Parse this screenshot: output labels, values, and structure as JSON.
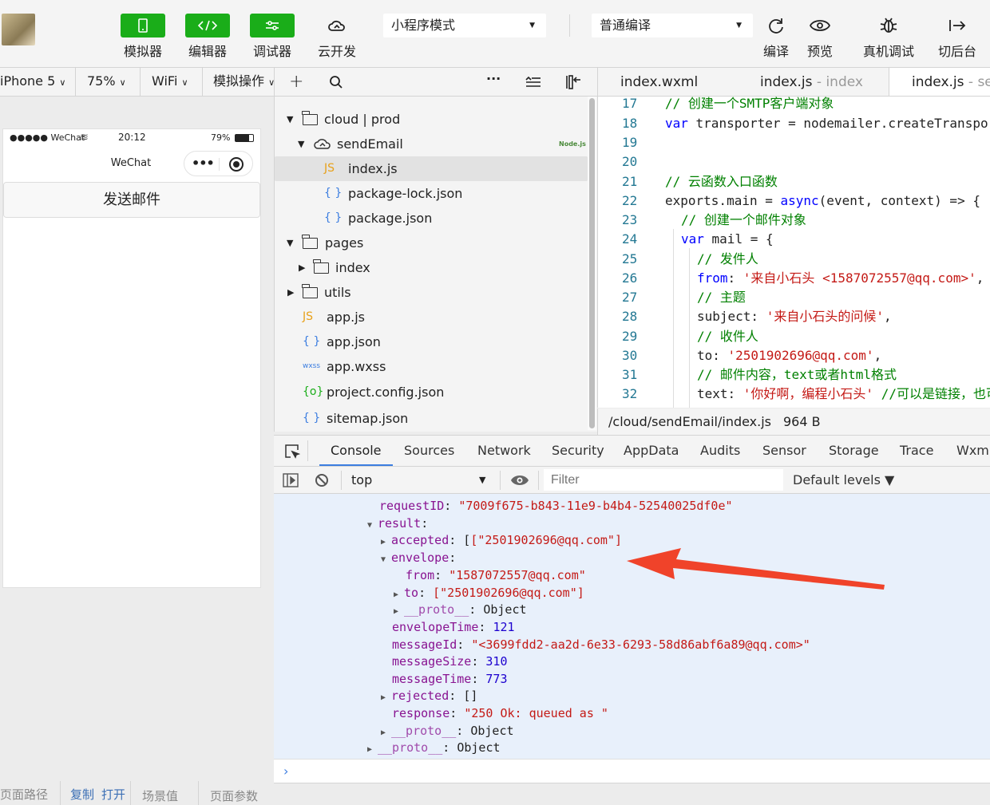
{
  "toolbar": {
    "simulator": "模拟器",
    "editor": "编辑器",
    "debugger": "调试器",
    "cloud": "云开发",
    "mode": "小程序模式",
    "compile_mode": "普通编译",
    "compile": "编译",
    "preview": "预览",
    "remote_debug": "真机调试",
    "background": "切后台"
  },
  "sim": {
    "device": "iPhone 5",
    "zoom": "75%",
    "network": "WiFi",
    "actions": "模拟操作",
    "carrier": "●●●●● WeChat",
    "time": "20:12",
    "battery": "79%",
    "title": "WeChat",
    "button": "发送邮件",
    "footer": [
      "页面路径",
      "复制",
      "打开",
      "场景值",
      "页面参数"
    ]
  },
  "tree": [
    {
      "name": "cloud | prod",
      "tag": ""
    },
    {
      "name": "sendEmail",
      "tag": "Node.js"
    },
    {
      "name": "index.js",
      "icon": "JS"
    },
    {
      "name": "package-lock.json",
      "icon": "{ }"
    },
    {
      "name": "package.json",
      "icon": "{ }"
    },
    {
      "name": "pages"
    },
    {
      "name": "index"
    },
    {
      "name": "utils"
    },
    {
      "name": "app.js",
      "icon": "JS"
    },
    {
      "name": "app.json",
      "icon": "{ }"
    },
    {
      "name": "app.wxss",
      "icon": "wxss"
    },
    {
      "name": "project.config.json",
      "icon": "{o}"
    },
    {
      "name": "sitemap.json",
      "icon": "{ }"
    }
  ],
  "tabs": [
    {
      "name": "index.wxml",
      "suffix": ""
    },
    {
      "name": "index.js",
      "suffix": " - index"
    },
    {
      "name": "index.js",
      "suffix": " - sendEmail"
    }
  ],
  "code": {
    "lines": [
      "17",
      "18",
      "19",
      "20",
      "21",
      "22",
      "23",
      "24",
      "25",
      "26",
      "27",
      "28",
      "29",
      "30",
      "31",
      "32"
    ],
    "l17": "// 创建一个SMTP客户端对象",
    "l18a": "var",
    "l18b": " transporter = nodemailer.createTransport({",
    "l21": "// 云函数入口函数",
    "l22a": "exports.main = ",
    "l22b": "async",
    "l22c": "(event, context) => {",
    "l23": "// 创建一个邮件对象",
    "l24a": "var",
    "l24b": " mail = {",
    "l25": "// 发件人",
    "l26a": "from",
    "l26b": ": ",
    "l26c": "'来自小石头 <1587072557@qq.com>'",
    "l26d": ",",
    "l27": "// 主题",
    "l28a": "subject: ",
    "l28b": "'来自小石头的问候'",
    "l28c": ",",
    "l29": "// 收件人",
    "l30a": "to: ",
    "l30b": "'2501902696@qq.com'",
    "l30c": ",",
    "l31": "// 邮件内容，text或者html格式",
    "l32a": "text: ",
    "l32b": "'你好啊，编程小石头'",
    "l32c": " //可以是链接，也可以是",
    "path": "/cloud/sendEmail/index.js",
    "size": "964 B"
  },
  "devtools": {
    "tabs": [
      "Console",
      "Sources",
      "Network",
      "Security",
      "AppData",
      "Audits",
      "Sensor",
      "Storage",
      "Trace",
      "Wxml"
    ],
    "context": "top",
    "filter_placeholder": "Filter",
    "levels": "Default levels ▼"
  },
  "console": {
    "requestID_key": "requestID",
    "requestID_val": "\"7009f675-b843-11e9-b4b4-52540025df0e\"",
    "result": "result",
    "accepted_key": "accepted",
    "accepted_val": "[\"2501902696@qq.com\"]",
    "envelope": "envelope",
    "from_key": "from",
    "from_val": "\"1587072557@qq.com\"",
    "to_key": "to",
    "to_val": "[\"2501902696@qq.com\"]",
    "proto": "__proto__",
    "object": "Object",
    "envelopeTime_key": "envelopeTime",
    "envelopeTime_val": "121",
    "messageId_key": "messageId",
    "messageId_val": "\"<3699fdd2-aa2d-6e33-6293-58d86abf6a89@qq.com>\"",
    "messageSize_key": "messageSize",
    "messageSize_val": "310",
    "messageTime_key": "messageTime",
    "messageTime_val": "773",
    "rejected_key": "rejected",
    "rejected_val": "[]",
    "response_key": "response",
    "response_val": "\"250 Ok: queued as \"",
    "prompt": "›"
  },
  "colors": {
    "green": "#1aad19",
    "arrow": "#f0432a",
    "console_bg": "#e8f0fb"
  }
}
